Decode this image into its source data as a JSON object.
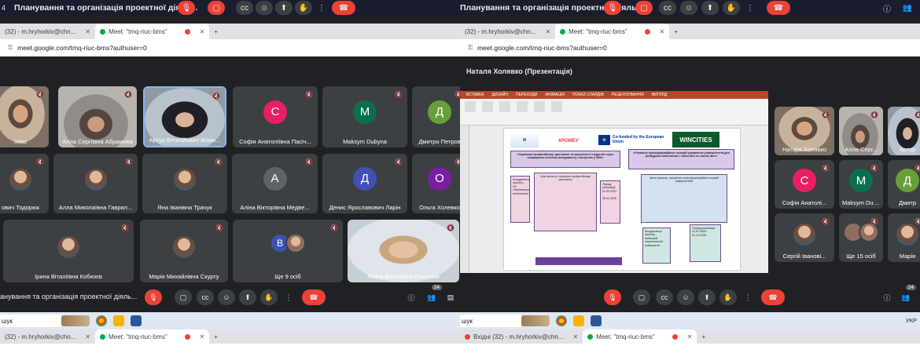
{
  "meeting": {
    "title": "Планування та організація проектної діяль...",
    "title_short": "анування та організація проектної діяль...",
    "top_title_right": "Планування та організація проектної діяльн...",
    "top_page_number": "4",
    "people_count": "24"
  },
  "browser": {
    "tab_gmail": "(32) - m.hryhorkiv@chn...",
    "tab_meet": "Meet: \"tmq-riuc-bms\"",
    "tab_gmail_right": "(32) - m.hryhorkiv@chn...",
    "tab_meet_right": "Meet: \"tmq-riuc-bms\"",
    "tab_close": "✕",
    "new_tab": "+",
    "url": "meet.google.com/tmq-riuc-bms?authuser=0",
    "bottom_tab_gmail": "(32) - m.hryhorkiv@chn...",
    "bottom_tab_meet": "Meet: \"tmq-riuc-bms\"",
    "bottom_tab_gmail_right": "Вхідні (32) - m.hryhorkiv@chn...",
    "bottom_tab_meet_right": "Meet: \"tmq-riuc-bms\""
  },
  "left_tiles": [
    {
      "name": "ляко",
      "kind": "video",
      "style": "warm"
    },
    {
      "name": "Алла Сергіївна Абрамова",
      "kind": "video",
      "style": "car"
    },
    {
      "name": "Артур Віталійович Жаво...",
      "kind": "video",
      "style": "office"
    },
    {
      "name": "Софія Анатоліївна Пасіч...",
      "kind": "avatar",
      "letter": "С",
      "color": "#e91e63"
    },
    {
      "name": "Maksym Dubyna",
      "kind": "avatar",
      "letter": "M",
      "color": "#0b6e4f"
    },
    {
      "name": "Дмитро Петров",
      "kind": "avatar",
      "letter": "Д",
      "color": "#689f38"
    },
    {
      "name": "ович Тодорюк",
      "kind": "photo"
    },
    {
      "name": "Алла Миколаївна Гаврил...",
      "kind": "photo"
    },
    {
      "name": "Яна Іванівна Трачук",
      "kind": "photo"
    },
    {
      "name": "Аліна Вікторівна Медве...",
      "kind": "avatar",
      "letter": "А",
      "color": "#5f6368"
    },
    {
      "name": "Денис Ярославович Ларін",
      "kind": "avatar",
      "letter": "Д",
      "color": "#3f51b5"
    },
    {
      "name": "Ольга Холевко",
      "kind": "avatar",
      "letter": "О",
      "color": "#7b1fa2"
    },
    {
      "name": "Ірина Віталіївна Кобизєв",
      "kind": "photo"
    },
    {
      "name": "Марія Михайлівна Скурту",
      "kind": "photo"
    },
    {
      "name": "Ще 9 осіб",
      "kind": "more",
      "letter": "В",
      "color": "#3f51b5"
    },
    {
      "name": "Марія Василівна Григорків",
      "kind": "video",
      "style": "light"
    }
  ],
  "presentation": {
    "presenter": "Наталя Холявко (Презентація)",
    "ribbon_tabs": [
      "ВСТАВКА",
      "ДИЗАЙН",
      "ПЕРЕХОДИ",
      "АНІМАЦІЯ",
      "ПОКАЗ СЛАЙДІВ",
      "РЕЦЕНЗУВАННЯ",
      "ВИГЛЯД"
    ],
    "eu_text": "Co-funded by the European Union",
    "logo_text": "WINCITIES",
    "logo_left": "КРОМЕУ",
    "box_left_title": "«Сприяння професійному зростанню та залученості студентів через покращення системи менеджменту і контролю у ЗВО»",
    "box_right_title": "«Розвиток трансформаційних позицій управління університетів для розбудови спільнотних і спільноти та сталих міст»",
    "box_center_left": "Ціль проекту: сприяння професійному зростанню",
    "box_center_right": "Мета проекту: зміцнення трансформаційних позицій університетів",
    "period_left": "Період реалізації: 01.03.2023 - 28.02.2026",
    "period_right": "Період реалізації: 01.01.2023 - 31.12.2026",
    "coord_left": "Координатор проекту - НУ «Чернігівська політехніка»",
    "coord_right": "Координатор проекту - Київський національний університет"
  },
  "right_tiles": [
    {
      "name": "Натаря Холявко",
      "kind": "video",
      "style": "warm"
    },
    {
      "name": "Алла Серг...",
      "kind": "video",
      "style": "car"
    },
    {
      "name": "Артур",
      "kind": "video",
      "style": "office"
    },
    {
      "name": "Софія Анатолі...",
      "kind": "avatar",
      "letter": "С",
      "color": "#e91e63"
    },
    {
      "name": "Maksym Dubyna",
      "kind": "avatar",
      "letter": "M",
      "color": "#0b6e4f"
    },
    {
      "name": "Дмитр",
      "kind": "avatar",
      "letter": "Д",
      "color": "#689f38"
    },
    {
      "name": "Сергій Іванові...",
      "kind": "photo"
    },
    {
      "name": "Ще 15 осіб",
      "kind": "more2"
    },
    {
      "name": "Марія",
      "kind": "photo"
    }
  ],
  "taskbar": {
    "search_left": "шук",
    "search_right": "шук",
    "lang": "УКР"
  },
  "colors": {
    "bg": "#202124",
    "tile": "#3c4043",
    "red": "#ea4335"
  }
}
